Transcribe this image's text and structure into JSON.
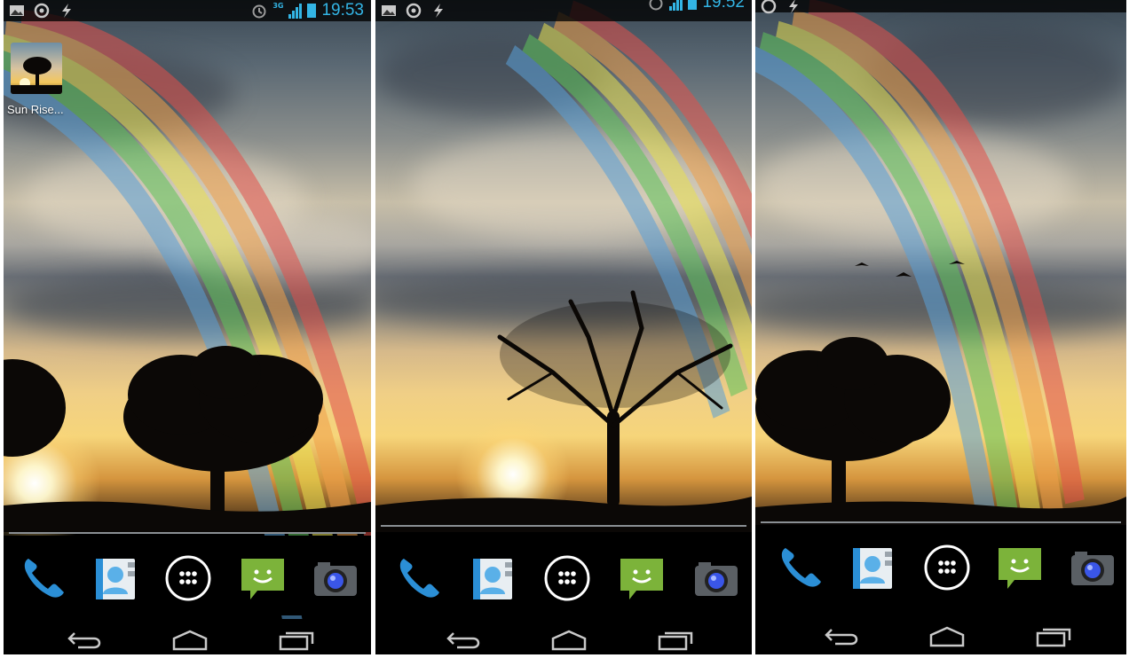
{
  "screens": [
    {
      "status_time": "19:53",
      "status_network": "3G",
      "home_shortcut": {
        "label": "Sun Rise...",
        "icon": "sunrise-tree-icon"
      },
      "dock": [
        "phone-icon",
        "contacts-icon",
        "app-drawer-icon",
        "messaging-icon",
        "camera-icon"
      ],
      "nav": [
        "back-icon",
        "home-icon",
        "recents-icon"
      ]
    },
    {
      "status_time": "19:52",
      "dock": [
        "phone-icon",
        "contacts-icon",
        "app-drawer-icon",
        "messaging-icon",
        "camera-icon"
      ],
      "nav": [
        "back-icon",
        "home-icon",
        "recents-icon"
      ]
    },
    {
      "dock": [
        "phone-icon",
        "contacts-icon",
        "app-drawer-icon",
        "messaging-icon",
        "camera-icon"
      ],
      "nav": [
        "back-icon",
        "home-icon",
        "recents-icon"
      ]
    }
  ],
  "colors": {
    "holo_blue": "#33b5e5",
    "phone_blue": "#2b8fd6",
    "message_green": "#7cb33a",
    "divider": "#8a8f94"
  }
}
